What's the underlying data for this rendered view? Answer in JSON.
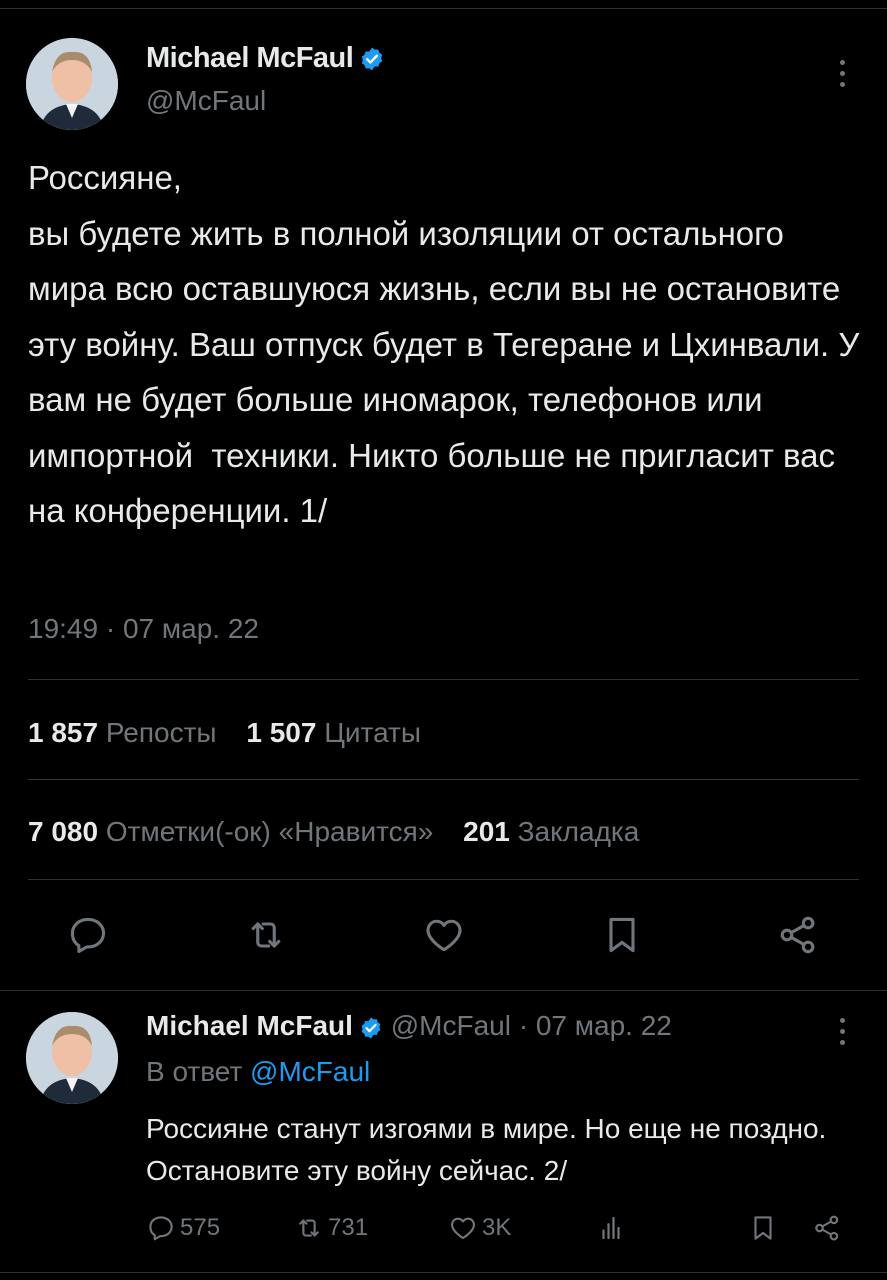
{
  "main": {
    "author_name": "Michael McFaul",
    "handle": "@McFaul",
    "text": "Россияне,\nвы будете жить в полной изоляции от остального мира всю оставшуюся жизнь, если вы не остановите эту войну. Ваш отпуск будет в Тегеране и Цхинвали. У вам не будет больше иномарок, телефонов или импортной  техники. Никто больше не пригласит вас на конференции. 1/",
    "timestamp": "19:49 · 07 мар. 22",
    "reposts_count": "1 857",
    "reposts_label": "Репосты",
    "quotes_count": "1 507",
    "quotes_label": "Цитаты",
    "likes_count": "7 080",
    "likes_label": "Отметки(-ок) «Нравится»",
    "bookmarks_count": "201",
    "bookmarks_label": "Закладка"
  },
  "reply": {
    "author_name": "Michael McFaul",
    "handle_date": "@McFaul · 07 мар. 22",
    "reply_prefix": "В ответ",
    "reply_to": "@McFaul",
    "text": "Россияне станут изгоями в мире. Но еще не поздно. Остановите эту войну сейчас. 2/",
    "comments": "575",
    "reposts": "731",
    "likes": "3K"
  },
  "colors": {
    "accent": "#1d9bf0",
    "muted": "#71767b",
    "text": "#e7e9ea",
    "background": "#000000"
  },
  "icons": [
    "verified-badge-icon",
    "more-vertical-icon",
    "reply-icon",
    "repost-icon",
    "like-icon",
    "bookmark-icon",
    "share-icon",
    "views-icon"
  ]
}
